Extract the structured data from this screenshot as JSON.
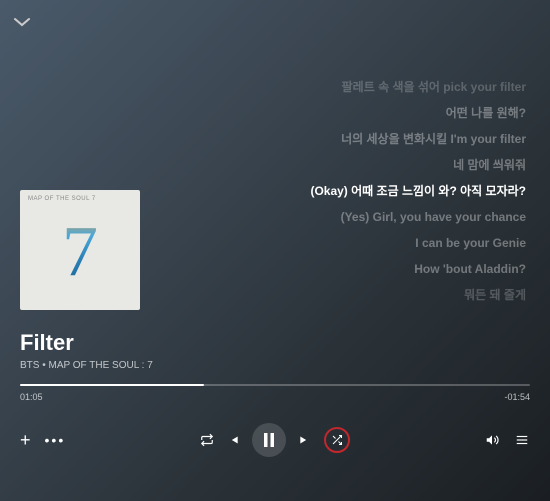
{
  "track": {
    "title": "Filter",
    "artist": "BTS",
    "album": "MAP OF THE SOUL : 7",
    "subtitle": "BTS • MAP OF THE SOUL : 7"
  },
  "album_art": {
    "top_label": "MAP OF THE SOUL   7",
    "glyph": "7"
  },
  "progress": {
    "elapsed": "01:05",
    "remaining": "-01:54",
    "percent": 36
  },
  "lyrics": [
    {
      "text": "팔레트 속 색을 섞어 pick your filter",
      "state": "dim"
    },
    {
      "text": "어떤 나를 원해?",
      "state": "normal"
    },
    {
      "text": "너의 세상을 변화시킬 I'm your filter",
      "state": "normal"
    },
    {
      "text": "네 맘에 씌워줘",
      "state": "normal"
    },
    {
      "text": "(Okay) 어때 조금 느낌이 와? 아직 모자라?",
      "state": "active"
    },
    {
      "text": "(Yes) Girl, you have your chance",
      "state": "normal"
    },
    {
      "text": "I can be your Genie",
      "state": "normal"
    },
    {
      "text": "How 'bout Aladdin?",
      "state": "normal"
    },
    {
      "text": "뭐든 돼 줄게",
      "state": "dim"
    }
  ],
  "controls": {
    "add": "+",
    "more": "•••"
  }
}
